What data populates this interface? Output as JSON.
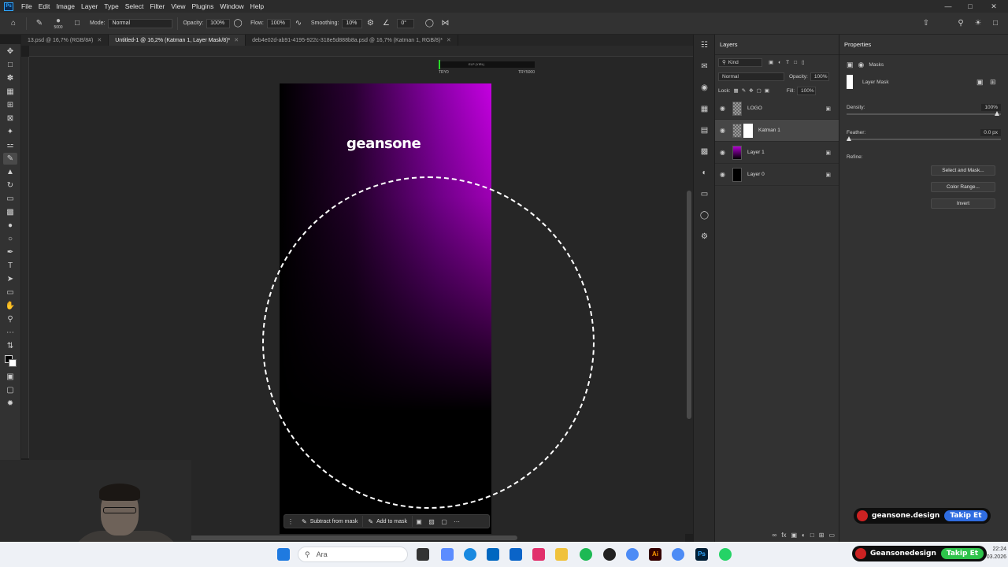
{
  "menubar": {
    "app_icon": "Ps",
    "items": [
      "File",
      "Edit",
      "Image",
      "Layer",
      "Type",
      "Select",
      "Filter",
      "View",
      "Plugins",
      "Window",
      "Help"
    ]
  },
  "options": {
    "brush_size": "5000",
    "mode_label": "Mode:",
    "mode_value": "Normal",
    "opacity_label": "Opacity:",
    "opacity_value": "100%",
    "flow_label": "Flow:",
    "flow_value": "100%",
    "smoothing_label": "Smoothing:",
    "smoothing_value": "10%",
    "angle_value": "0°"
  },
  "tabs": [
    {
      "label": "13.psd @ 16,7% (RGB/8#)",
      "active": false
    },
    {
      "label": "Untitled-1 @ 16,2% (Katman 1, Layer Mask/8)*",
      "active": true
    },
    {
      "label": "deb4e02d-ab91-4195-922c-318e5d888b8a.psd @ 16,7% (Katman 1, RGB/8)*",
      "active": false
    }
  ],
  "canvas": {
    "logo_text": "geansone",
    "ruler_left": "TRY0",
    "ruler_right": "TRY5000",
    "ruler_caption": "ELP (YIRL)"
  },
  "context_bar": {
    "subtract_label": "Subtract from mask",
    "add_label": "Add to mask"
  },
  "layers_panel": {
    "title": "Layers",
    "kind_label": "Kind",
    "blend_mode": "Normal",
    "opacity_label": "Opacity:",
    "opacity_value": "100%",
    "lock_label": "Lock:",
    "fill_label": "Fill:",
    "fill_value": "100%",
    "layers": [
      {
        "name": "LOGO",
        "selected": false,
        "locked": true
      },
      {
        "name": "Katman 1",
        "selected": true,
        "locked": false
      },
      {
        "name": "Layer 1",
        "selected": false,
        "locked": true
      },
      {
        "name": "Layer 0",
        "selected": false,
        "locked": true
      }
    ]
  },
  "properties_panel": {
    "title": "Properties",
    "section": "Masks",
    "mask_label": "Layer Mask",
    "density_label": "Density:",
    "density_value": "100%",
    "feather_label": "Feather:",
    "feather_value": "0.0 px",
    "refine_label": "Refine:",
    "select_mask_button": "Select and Mask...",
    "color_range_button": "Color Range...",
    "invert_button": "Invert"
  },
  "badges": [
    {
      "name": "geansone.design",
      "action": "Takip Et",
      "color": "#2f6de1"
    },
    {
      "name": "Geansonedesign",
      "action": "Takip Et",
      "color": "#2ec44b"
    }
  ],
  "taskbar": {
    "search_placeholder": "Ara",
    "clock_time": "22:24",
    "clock_date": "03.2026"
  },
  "colors": {
    "accent_blue": "#31a8ff",
    "gradient_purple": "#c400e0"
  }
}
